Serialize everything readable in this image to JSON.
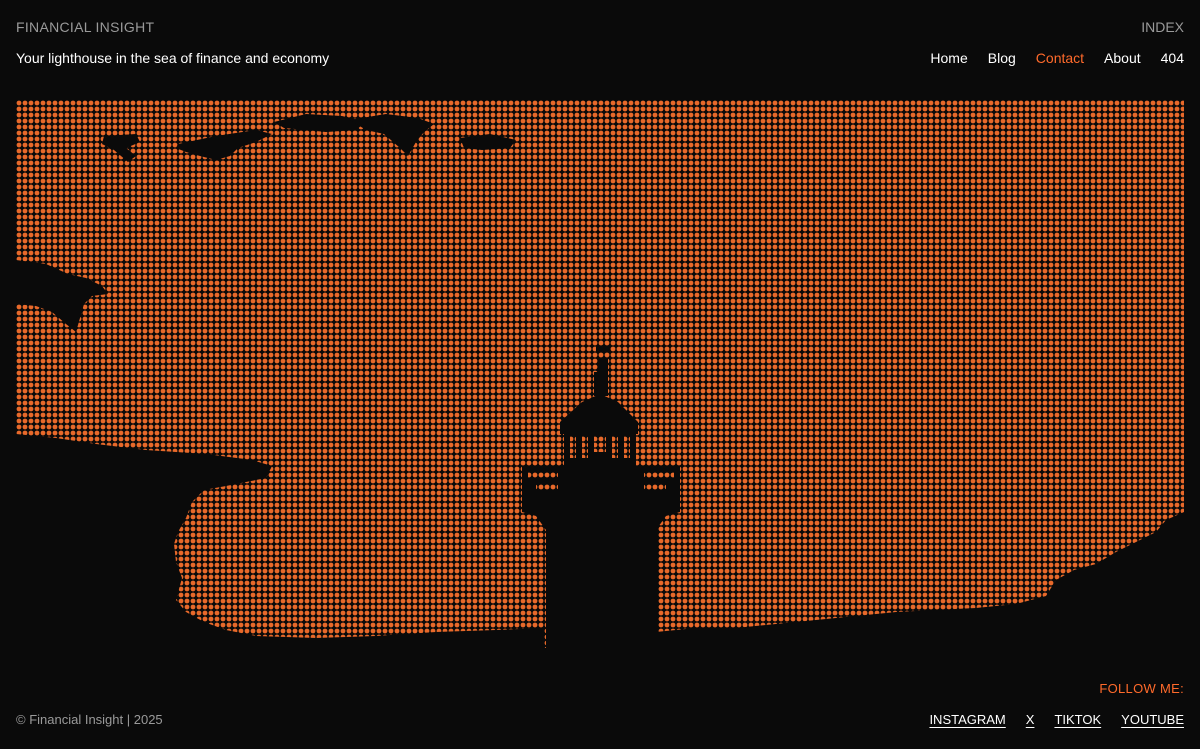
{
  "header": {
    "brand": "FINANCIAL INSIGHT",
    "index_label": "INDEX",
    "tagline": "Your lighthouse in the sea of finance and economy"
  },
  "nav": {
    "items": [
      {
        "label": "Home"
      },
      {
        "label": "Blog"
      },
      {
        "label": "Contact"
      },
      {
        "label": "About"
      },
      {
        "label": "404"
      }
    ],
    "active": "Contact"
  },
  "hero": {
    "dot_color": "#e8692a",
    "background_color": "#0a0a0a"
  },
  "footer": {
    "copyright": "© Financial Insight | 2025",
    "follow_label": "FOLLOW ME:",
    "social": [
      {
        "label": "INSTAGRAM"
      },
      {
        "label": "X"
      },
      {
        "label": "TIKTOK"
      },
      {
        "label": "YOUTUBE"
      }
    ]
  },
  "colors": {
    "accent": "#ff6a2b",
    "muted": "#9a9a9a",
    "text": "#ffffff"
  }
}
